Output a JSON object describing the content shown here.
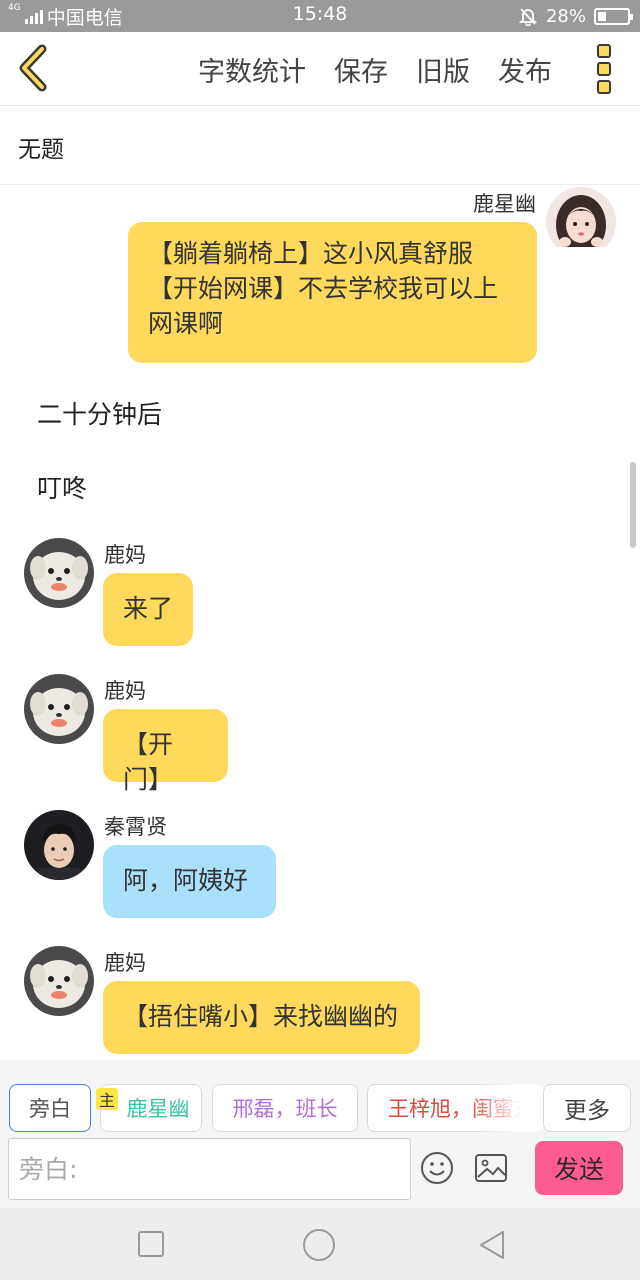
{
  "status_bar": {
    "network": "4G",
    "carrier": "中国电信",
    "time": "15:48",
    "battery": "28%",
    "battery_level": 0.28
  },
  "toolbar": {
    "word_count": "字数统计",
    "save": "保存",
    "old_version": "旧版",
    "publish": "发布"
  },
  "story": {
    "title": "无题"
  },
  "messages": [
    {
      "type": "bubble",
      "side": "right",
      "name": "鹿星幽",
      "color": "#ffd95c",
      "lines": [
        "【躺着躺椅上】这小风真舒服",
        "【开始网课】不去学校我可以上",
        "网课啊"
      ]
    },
    {
      "type": "narration",
      "text": "二十分钟后"
    },
    {
      "type": "narration",
      "text": "叮咚"
    },
    {
      "type": "bubble",
      "side": "left",
      "name": "鹿妈",
      "color": "#ffd95c",
      "text": "来了"
    },
    {
      "type": "bubble",
      "side": "left",
      "name": "鹿妈",
      "color": "#ffd95c",
      "text": "【开门】"
    },
    {
      "type": "bubble",
      "side": "left",
      "name": "秦霄贤",
      "color": "#a9e0fb",
      "text": "阿，阿姨好"
    },
    {
      "type": "bubble",
      "side": "left",
      "name": "鹿妈",
      "color": "#ffd95c",
      "text": "【捂住嘴小】来找幽幽的"
    }
  ],
  "characters": {
    "narration": "旁白",
    "main_badge": "主",
    "items": [
      {
        "label": "鹿星幽",
        "color": "#3fc1a8"
      },
      {
        "label": "邢磊，班长",
        "color": "#b070d8"
      },
      {
        "label": "王梓旭，闺蜜对象",
        "color": "#e0483e"
      }
    ],
    "more": "更多"
  },
  "composer": {
    "placeholder": "旁白:",
    "send": "发送"
  }
}
